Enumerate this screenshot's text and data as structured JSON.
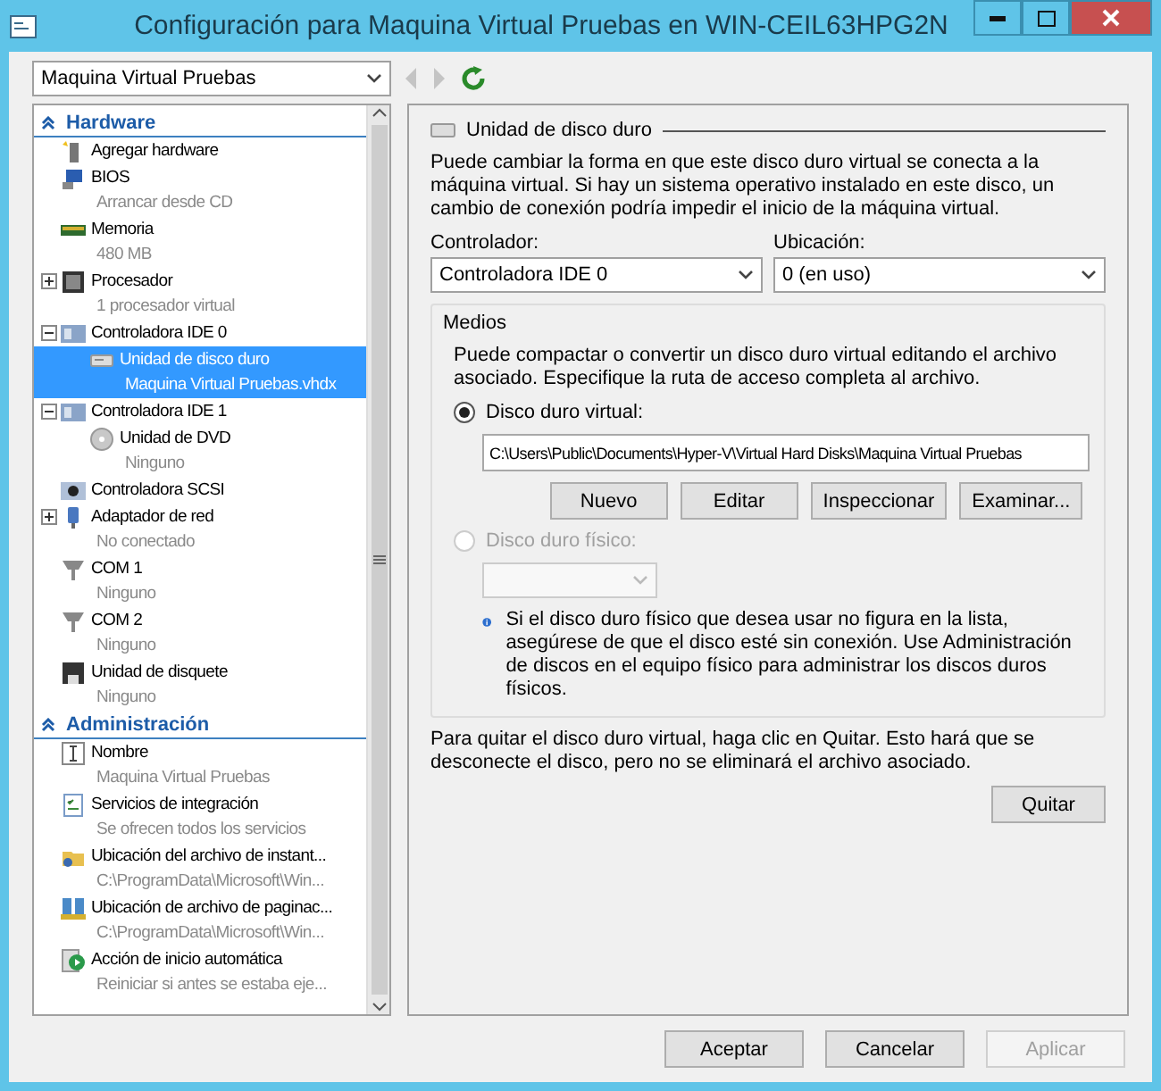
{
  "window": {
    "title": "Configuración para Maquina Virtual Pruebas en WIN-CEIL63HPG2N"
  },
  "toolbar": {
    "vm_select": "Maquina Virtual Pruebas",
    "nav": [
      {
        "kind": "back",
        "disabled": true
      },
      {
        "kind": "forward",
        "disabled": true
      },
      {
        "kind": "refresh",
        "disabled": false
      }
    ]
  },
  "sidebar": {
    "sections": [
      {
        "title": "Hardware",
        "items": [
          {
            "kind": "add",
            "label": "Agregar hardware",
            "selected": false
          },
          {
            "kind": "bios",
            "label": "BIOS",
            "detail": "Arrancar desde CD",
            "selected": false
          },
          {
            "kind": "memory",
            "label": "Memoria",
            "detail": "480 MB",
            "selected": false
          },
          {
            "kind": "cpu",
            "label": "Procesador",
            "detail": "1 procesador virtual",
            "expanded": false,
            "selected": false
          },
          {
            "kind": "controller",
            "label": "Controladora IDE 0",
            "expanded": true,
            "selected": false,
            "children": [
              {
                "kind": "disk",
                "label": "Unidad de disco duro",
                "detail": "Maquina Virtual Pruebas.vhdx",
                "selected": true
              }
            ]
          },
          {
            "kind": "controller",
            "label": "Controladora IDE 1",
            "expanded": true,
            "selected": false,
            "children": [
              {
                "kind": "dvd",
                "label": "Unidad de DVD",
                "detail": "Ninguno",
                "selected": false
              }
            ]
          },
          {
            "kind": "scsi",
            "label": "Controladora SCSI",
            "selected": false
          },
          {
            "kind": "network",
            "label": "Adaptador de red",
            "detail": "No conectado",
            "expanded": false,
            "selected": false
          },
          {
            "kind": "port",
            "label": "COM 1",
            "detail": "Ninguno",
            "selected": false
          },
          {
            "kind": "port",
            "label": "COM 2",
            "detail": "Ninguno",
            "selected": false
          },
          {
            "kind": "floppy",
            "label": "Unidad de disquete",
            "detail": "Ninguno",
            "selected": false
          }
        ]
      },
      {
        "title": "Administración",
        "items": [
          {
            "kind": "name",
            "label": "Nombre",
            "detail": "Maquina Virtual Pruebas",
            "selected": false
          },
          {
            "kind": "services",
            "label": "Servicios de integración",
            "detail": "Se ofrecen todos los servicios",
            "selected": false
          },
          {
            "kind": "folder",
            "label": "Ubicación del archivo de instant...",
            "detail": "C:\\ProgramData\\Microsoft\\Win...",
            "selected": false
          },
          {
            "kind": "paging",
            "label": "Ubicación de archivo de paginac...",
            "detail": "C:\\ProgramData\\Microsoft\\Win...",
            "selected": false
          },
          {
            "kind": "autostart",
            "label": "Acción de inicio automática",
            "detail": "Reiniciar si antes se estaba eje...",
            "selected": false
          }
        ]
      }
    ]
  },
  "panel": {
    "title": "Unidad de disco duro",
    "intro": "Puede cambiar la forma en que este disco duro virtual se conecta a la máquina virtual. Si hay un sistema operativo instalado en este disco, un cambio de conexión podría impedir el inicio de la máquina virtual.",
    "controller": {
      "label": "Controlador:",
      "value": "Controladora IDE 0"
    },
    "location": {
      "label": "Ubicación:",
      "value": "0 (en uso)"
    },
    "media": {
      "title": "Medios",
      "text": "Puede compactar o convertir un disco duro virtual editando el archivo asociado. Especifique la ruta de acceso completa al archivo.",
      "options": [
        {
          "label": "Disco duro virtual:",
          "selected": true,
          "disabled": false
        },
        {
          "label": "Disco duro físico:",
          "selected": false,
          "disabled": true
        }
      ],
      "path": "C:\\Users\\Public\\Documents\\Hyper-V\\Virtual Hard Disks\\Maquina Virtual Pruebas",
      "buttons": [
        "Nuevo",
        "Editar",
        "Inspeccionar",
        "Examinar..."
      ],
      "info": "Si el disco duro físico que desea usar no figura en la lista, asegúrese de que el disco esté sin conexión. Use Administración de discos en el equipo físico para administrar los discos duros físicos."
    },
    "remove_text": "Para quitar el disco duro virtual, haga clic en Quitar. Esto hará que se desconecte el disco, pero no se eliminará el archivo asociado.",
    "remove_button": "Quitar"
  },
  "footer_buttons": [
    {
      "label": "Aceptar",
      "disabled": false
    },
    {
      "label": "Cancelar",
      "disabled": false
    },
    {
      "label": "Aplicar",
      "disabled": true
    }
  ]
}
